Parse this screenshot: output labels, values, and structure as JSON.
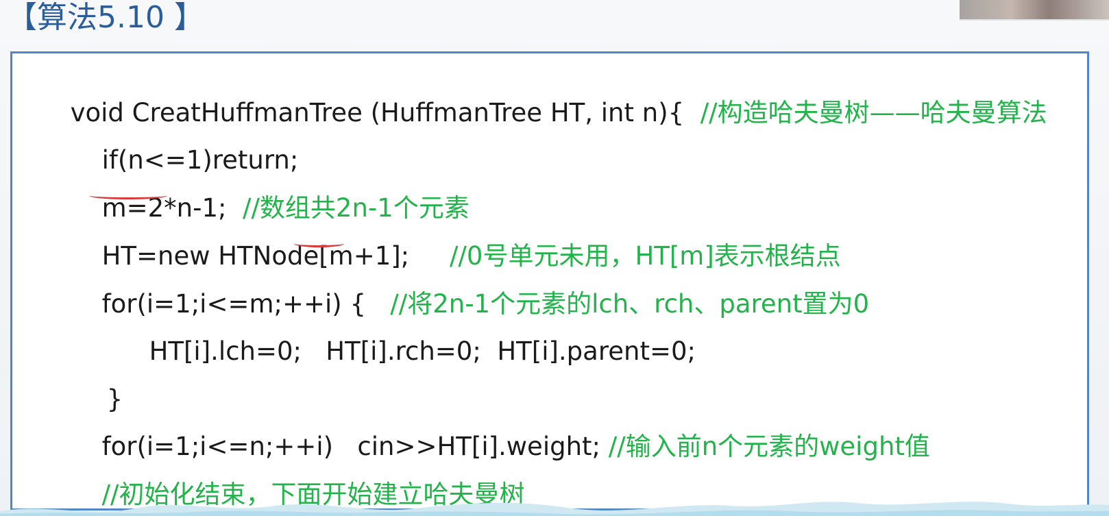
{
  "title": "【算法5.10 】",
  "code_lines": [
    {
      "code": "void CreatHuffmanTree (HuffmanTree HT, int n){  ",
      "comment": "//构造哈夫曼树——哈夫曼算法"
    },
    {
      "code": "if(n<=1)return;",
      "comment": ""
    },
    {
      "code": "m=2*n-1;  ",
      "comment": "//数组共2n-1个元素"
    },
    {
      "code": "HT=new HTNode[m+1];     ",
      "comment": "//0号单元未用，HT[m]表示根结点"
    },
    {
      "code": "for(i=1;i<=m;++i) {   ",
      "comment": "//将2n-1个元素的lch、rch、parent置为0"
    },
    {
      "code": "HT[i].lch=0;   HT[i].rch=0;  HT[i].parent=0;",
      "comment": ""
    },
    {
      "code": "}",
      "comment": ""
    },
    {
      "code": "for(i=1;i<=n;++i)   cin>>HT[i].weight; ",
      "comment": "//输入前n个元素的weight值"
    },
    {
      "code": "",
      "comment": "//初始化结束，下面开始建立哈夫曼树"
    }
  ],
  "colors": {
    "title": "#2b5d9b",
    "border": "#4e86c7",
    "code": "#1a1a1a",
    "comment": "#22b34a",
    "annotation": "#d83b3b"
  }
}
